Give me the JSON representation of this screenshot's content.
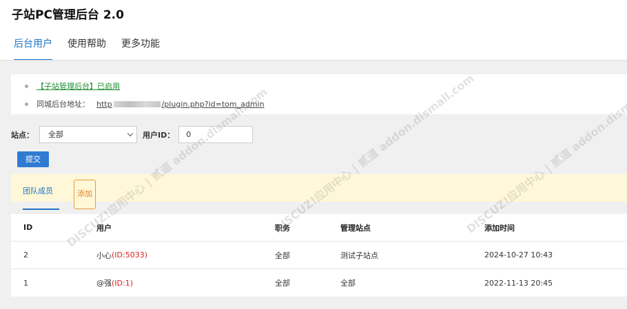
{
  "app": {
    "title": "子站PC管理后台 2.0"
  },
  "nav": {
    "tabs": [
      {
        "label": "后台用户"
      },
      {
        "label": "使用帮助"
      },
      {
        "label": "更多功能"
      }
    ]
  },
  "notice": {
    "enabled_text": "【子站管理后台】已启用",
    "address_label": "同城后台地址：",
    "address_prefix": "http",
    "address_suffix": "/plugin.php?id=tom_admin"
  },
  "filters": {
    "site_label": "站点：",
    "site_value": "全部",
    "uid_label": "用户ID：",
    "uid_value": "0"
  },
  "submit_label": "提交",
  "subtabs": {
    "team": "团队成员",
    "add": "添加"
  },
  "table": {
    "headers": {
      "id": "ID",
      "user": "用户",
      "position": "职务",
      "site": "管理站点",
      "time": "添加时间"
    },
    "rows": [
      {
        "id": "2",
        "name": "小心",
        "uid": "(ID:5033)",
        "position": "全部",
        "site": "测试子站点",
        "time": "2024-10-27 10:43"
      },
      {
        "id": "1",
        "name": "@强",
        "uid": "(ID:1)",
        "position": "全部",
        "site": "全部",
        "time": "2022-11-13 20:45"
      }
    ]
  },
  "watermark": {
    "text": "DISCUZ!应用中心 | 贰道 addon.dismall.com"
  },
  "colors": {
    "accent": "#1e73c8",
    "button": "#2f7bd2",
    "enabled": "#1a8f2c",
    "add_orange": "#e67e22",
    "uid_red": "#d9251d",
    "tabbar_bg": "#fff8d8"
  }
}
